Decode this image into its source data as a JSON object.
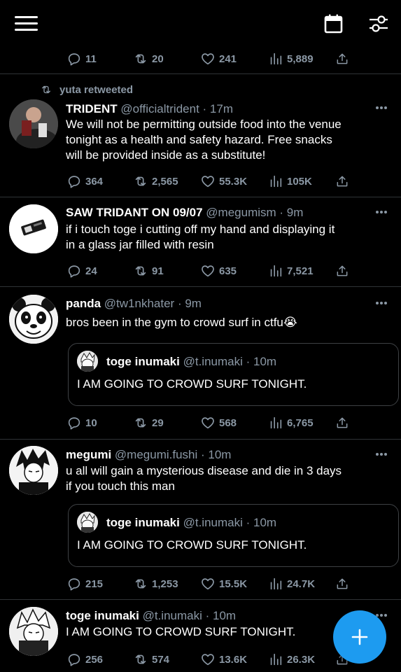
{
  "top_actions": {
    "reply": "11",
    "retweet": "20",
    "like": "241",
    "views": "5,889"
  },
  "tweets": [
    {
      "retweeted_by": "yuta retweeted",
      "name": "TRIDENT",
      "handle": "@officialtrident",
      "time": "· 17m",
      "text": [
        "We will not be permitting outside food into the venue",
        "tonight as a health and safety hazard. Free snacks",
        "will be provided inside as a substitute!"
      ],
      "reply": "364",
      "retweet": "2,565",
      "like": "55.3K",
      "views": "105K"
    },
    {
      "name": "SAW TRIDANT ON 09/07",
      "handle": "@megumism",
      "time": "· 9m",
      "text": [
        "if i touch toge i cutting off my hand and displaying it",
        "in a glass jar filled with resin"
      ],
      "reply": "24",
      "retweet": "91",
      "like": "635",
      "views": "7,521"
    },
    {
      "name": "panda",
      "handle": "@tw1nkhater",
      "time": "· 9m",
      "text": [
        "bros been in the gym to crowd surf in ctfu😭"
      ],
      "quote": {
        "name": "toge inumaki",
        "handle": "@t.inumaki",
        "time": "· 10m",
        "text": "I AM GOING TO CROWD SURF TONIGHT."
      },
      "reply": "10",
      "retweet": "29",
      "like": "568",
      "views": "6,765"
    },
    {
      "name": "megumi",
      "handle": "@megumi.fushi",
      "time": "· 10m",
      "text": [
        "u all will gain a mysterious disease and die in 3 days",
        "if you touch this man"
      ],
      "quote": {
        "name": "toge inumaki",
        "handle": "@t.inumaki",
        "time": "· 10m",
        "text": "I AM GOING TO CROWD SURF TONIGHT."
      },
      "reply": "215",
      "retweet": "1,253",
      "like": "15.5K",
      "views": "24.7K"
    },
    {
      "name": "toge inumaki",
      "handle": "@t.inumaki",
      "time": "· 10m",
      "text": [
        "I AM GOING TO CROWD SURF TONIGHT."
      ],
      "reply": "256",
      "retweet": "574",
      "like": "13.6K",
      "views": "26.3K"
    }
  ],
  "icons": {
    "menu": "hamburger-icon",
    "calendar": "calendar-icon",
    "filter": "filter-icon",
    "compose": "plus-icon",
    "reply": "reply-icon",
    "retweet": "retweet-icon",
    "like": "heart-icon",
    "views": "views-icon",
    "share": "share-icon",
    "more": "more-icon"
  },
  "colors": {
    "background": "#000000",
    "text": "#e7e9ea",
    "muted": "#8b98a5",
    "accent": "#1d9bf0",
    "divider": "#2f3336"
  }
}
